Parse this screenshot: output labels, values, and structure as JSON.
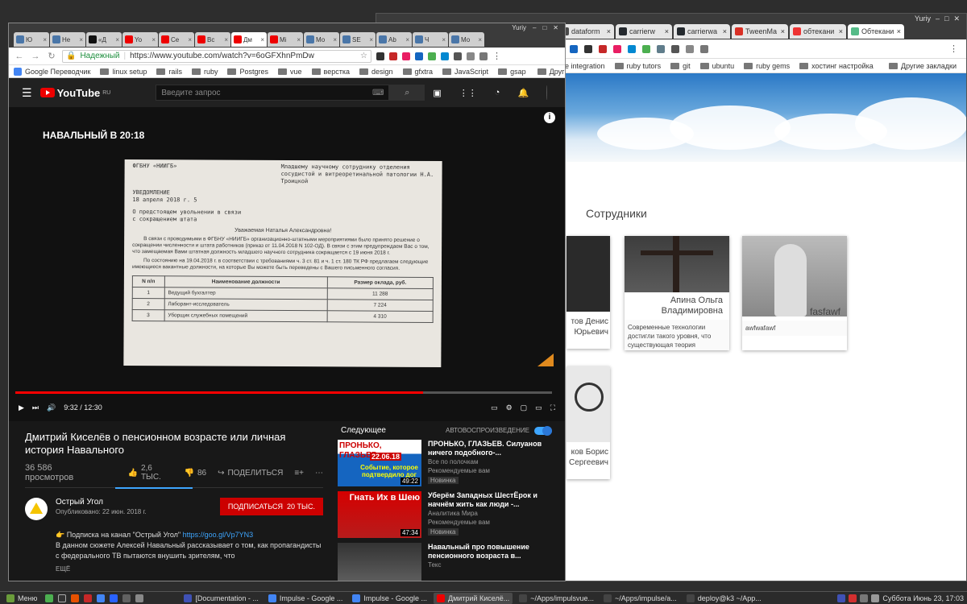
{
  "back_window": {
    "user": "Yuriy",
    "tabs": [
      {
        "label": "dataform",
        "color": "#4a4a4a"
      },
      {
        "label": "carrierw",
        "color": "#24292e"
      },
      {
        "label": "carrierwa",
        "color": "#24292e"
      },
      {
        "label": "TweenMa",
        "color": "#d93025"
      },
      {
        "label": "обтекани",
        "color": "#e33"
      },
      {
        "label": "Обтекани",
        "color": "#5b8"
      }
    ],
    "bookmarks": [
      "e integration",
      "ruby tutors",
      "git",
      "ubuntu",
      "ruby gems",
      "хостинг настройка"
    ],
    "other_bookmarks": "Другие закладки",
    "section_title": "Сотрудники",
    "cards": [
      {
        "name": "Апина Ольга Владимировна",
        "desc": "Современные технологии достигли такого уровня, что существующая теория"
      },
      {
        "name": "fasfawf",
        "desc": "awfwafawf"
      }
    ],
    "partial_cards": [
      {
        "name_tail": "тов Денис",
        "name_tail2": "Юрьевич"
      },
      {
        "name_tail": "ков Борис",
        "name_tail2": "Сергеевич"
      }
    ]
  },
  "front_window": {
    "user": "Yuriy",
    "tabs": [
      {
        "label": "Ю",
        "color": "#4a76a8"
      },
      {
        "label": "Не",
        "color": "#4a76a8"
      },
      {
        "label": "«Д",
        "color": "#111"
      },
      {
        "label": "Yo",
        "color": "#e00"
      },
      {
        "label": "Се",
        "color": "#e00"
      },
      {
        "label": "Вс",
        "color": "#e00"
      },
      {
        "label": "Дм",
        "color": "#e00",
        "active": true
      },
      {
        "label": "Мі",
        "color": "#e00"
      },
      {
        "label": "Мо",
        "color": "#4a76a8"
      },
      {
        "label": "SE",
        "color": "#4a76a8"
      },
      {
        "label": "Ab",
        "color": "#4a76a8"
      },
      {
        "label": "Ч",
        "color": "#4a76a8"
      },
      {
        "label": "Мо",
        "color": "#4a76a8"
      }
    ],
    "secure_label": "Надежный",
    "url": "https://www.youtube.com/watch?v=6oGFXhnPmDw",
    "bookmarks": [
      "Google Переводчик",
      "linux setup",
      "rails",
      "ruby",
      "Postgres",
      "vue",
      "верстка",
      "design",
      "gfxtra",
      "JavaScript",
      "gsap"
    ],
    "other_bookmarks": "Другие закладки"
  },
  "youtube": {
    "logo": "YouTube",
    "logo_region": "RU",
    "search_placeholder": "Введите запрос",
    "video_overlay_title": "НАВАЛЬНЫЙ В 20:18",
    "doc": {
      "org": "ФГБНУ «НИИГБ»",
      "recipient": "Младшему научному сотруднику отделения сосудистой и витреоретинальной патологии Н.А. Троицкой",
      "notice": "УВЕДОМЛЕНИЕ",
      "notice_date": "18 апреля 2018 г. 5",
      "subject": "О предстоящем увольнении в связи с сокращением штата",
      "greeting": "Уважаемая Наталья Александровна!",
      "para1": "В связи с проводимыми в ФГБНУ «НИИГБ» организационно-штатными мероприятиями было принято решение о сокращении численности и штата работников (приказ от 11.04.2018 N 102-ОД). В связи с этим предупреждаем Вас о том, что замещаемая Вами штатная должность младшего научного сотрудника сокращается с 19 июня 2018 г.",
      "para2": "По состоянию на 19.04.2018 г. в соответствии с требованиями ч. 3 ст. 81 и ч. 1 ст. 180 ТК РФ предлагаем следующие имеющиеся вакантные должности, на которые Вы можете быть переведены с Вашего письменного согласия.",
      "table_headers": [
        "N п/п",
        "Наименование должности",
        "Размер оклада, руб."
      ],
      "table_rows": [
        [
          "1",
          "Ведущий бухгалтер",
          "11 288"
        ],
        [
          "2",
          "Лаборант-исследователь",
          "7 224"
        ],
        [
          "3",
          "Уборщик служебных помещений",
          "4 310"
        ]
      ]
    },
    "time": "9:32 / 12:30",
    "progress": 0.76,
    "video_title": "Дмитрий Киселёв о пенсионном возрасте или личная история Навального",
    "views": "36 586 просмотров",
    "likes": "2,6 ТЫС.",
    "dislikes": "86",
    "share": "ПОДЕЛИТЬСЯ",
    "channel": "Острый Угол",
    "published": "Опубликовано: 22 июн. 2018 г.",
    "subscribe": "ПОДПИСАТЬСЯ",
    "subscribers": "20 ТЫС.",
    "desc_line1": "👉 Подписка на канал \"Острый Угол\"",
    "desc_link": "https://goo.gl/Vp7YN3",
    "desc_line2": "В данном сюжете Алексей Навальный рассказывает о том, как пропагандисты с федерального ТВ пытаются внушить зрителям, что",
    "more": "ЕЩЁ",
    "next_label": "Следующее",
    "autoplay_label": "АВТОВОСПРОИЗВЕДЕНИЕ",
    "up_next": [
      {
        "title": "ПРОНЬКО, ГЛАЗЬЕВ. Силуанов ничего подобного-...",
        "channel": "Все по полочкам",
        "reason": "Рекомендуемые вам",
        "badge": "Новинка",
        "duration": "49:22",
        "thumb_text": "ПРОНЬКО, ГЛАЗЬЕВ",
        "thumb_date": "22.06.18",
        "thumb_caption": "Событие, которое подтвердило дог"
      },
      {
        "title": "Уберём Западных ШестЁрок и начнём жить как люди -...",
        "channel": "Аналитика Мира",
        "reason": "Рекомендуемые вам",
        "badge": "Новинка",
        "duration": "47:34",
        "thumb_text": "Гнать Их в Шею"
      },
      {
        "title": "Навальный про повышение пенсионного возраста в...",
        "channel": "Текс",
        "reason": "",
        "badge": "",
        "duration": "",
        "thumb_text": ""
      }
    ]
  },
  "taskbar": {
    "menu": "Меню",
    "tasks": [
      "[Documentation - ...",
      "Impulse - Google ...",
      "Impulse - Google ...",
      "Дмитрий Киселё...",
      "~/Apps/impulsvue...",
      "~/Apps/impulse/a...",
      "deploy@k3 ~/App..."
    ],
    "clock": "Суббота Июнь 23, 17:03"
  }
}
